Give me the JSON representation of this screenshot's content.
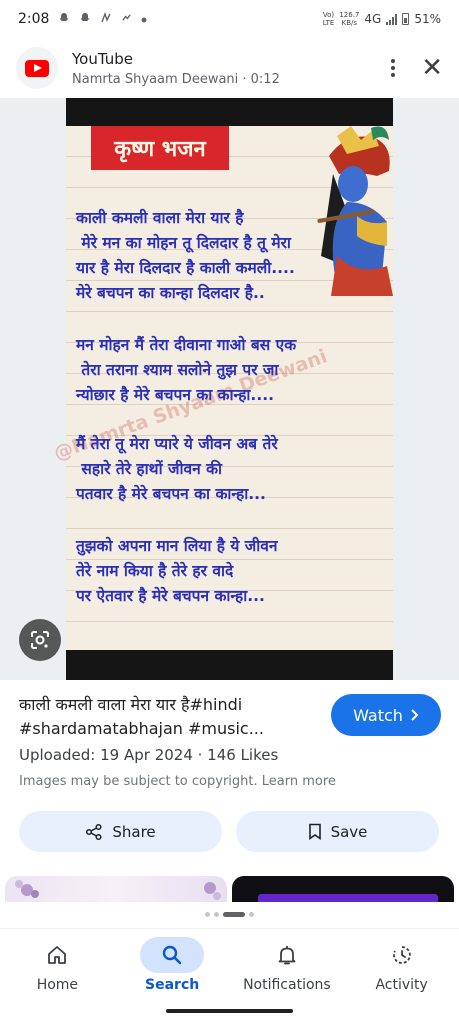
{
  "status_bar": {
    "time": "2:08",
    "volte": "Vo)",
    "lte": "LTE",
    "speed": "126.7",
    "speed_unit": "KB/s",
    "network": "4G",
    "battery": "51%"
  },
  "header": {
    "app_name": "YouTube",
    "subtitle": "Namrta Shyaam Deewani · 0:12"
  },
  "image": {
    "title": "कृष्ण भजन",
    "watermark": "@Namrta Shyaam Deewani",
    "stanza1": "काली कमली वाला मेरा यार है\n मेरे मन का मोहन तू दिलदार है तू मेरा\nयार है मेरा दिलदार है काली कमली....\nमेरे बचपन का कान्हा दिलदार है..",
    "stanza2": "मन मोहन मैं तेरा दीवाना गाओ बस एक\n तेरा तराना श्याम सलोने तुझ पर जा\nन्योछार है मेरे बचपन का कान्हा....",
    "stanza3": "मैं तेरा तू मेरा प्यारे ये जीवन अब तेरे\n सहारे तेरे हाथों जीवन की\nपतवार है मेरे बचपन का कान्हा...",
    "stanza4": "तुझको अपना मान लिया है ये जीवन\nतेरे नाम किया है तेरे हर वादे\nपर ऐतवार है मेरे बचपन कान्हा..."
  },
  "result": {
    "title_line1": "काली कमली वाला मेरा यार है#hindi",
    "title_line2": "#shardamatabhajan #music...",
    "watch_label": "Watch",
    "meta": "Uploaded: 19 Apr 2024  ·  146 Likes",
    "copyright": "Images may be subject to copyright. Learn more",
    "share_label": "Share",
    "save_label": "Save"
  },
  "nav": {
    "items": [
      {
        "label": "Home",
        "icon": "home-icon"
      },
      {
        "label": "Search",
        "icon": "search-icon",
        "active": true
      },
      {
        "label": "Notifications",
        "icon": "bell-icon"
      },
      {
        "label": "Activity",
        "icon": "activity-icon"
      }
    ]
  },
  "colors": {
    "accent": "#1a73e8",
    "verse_text": "#2b2fb8",
    "title_banner": "#d8262a",
    "youtube_red": "#ff0000"
  }
}
